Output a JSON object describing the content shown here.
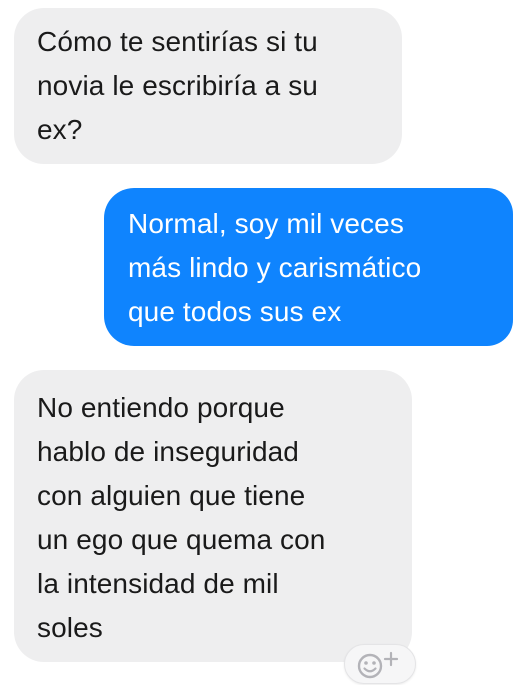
{
  "conversation": {
    "messages": [
      {
        "direction": "received",
        "text": "Cómo te sentirías si tu\nnovia le escribiría a su\nex?"
      },
      {
        "direction": "sent",
        "text": "Normal, soy mil veces\nmás lindo y carismático\nque todos sus ex"
      },
      {
        "direction": "received",
        "text": "No entiendo porque\nhablo de inseguridad\ncon alguien que tiene\nun ego que quema con\nla intensidad de mil\nsoles"
      }
    ]
  },
  "reaction": {
    "icon": "add-reaction-icon"
  },
  "colors": {
    "received_bubble": "#eeeeef",
    "received_text": "#1a1a1a",
    "sent_bubble": "#0f84fe",
    "sent_text": "#ffffff",
    "reaction_icon": "#b3b3b8"
  }
}
